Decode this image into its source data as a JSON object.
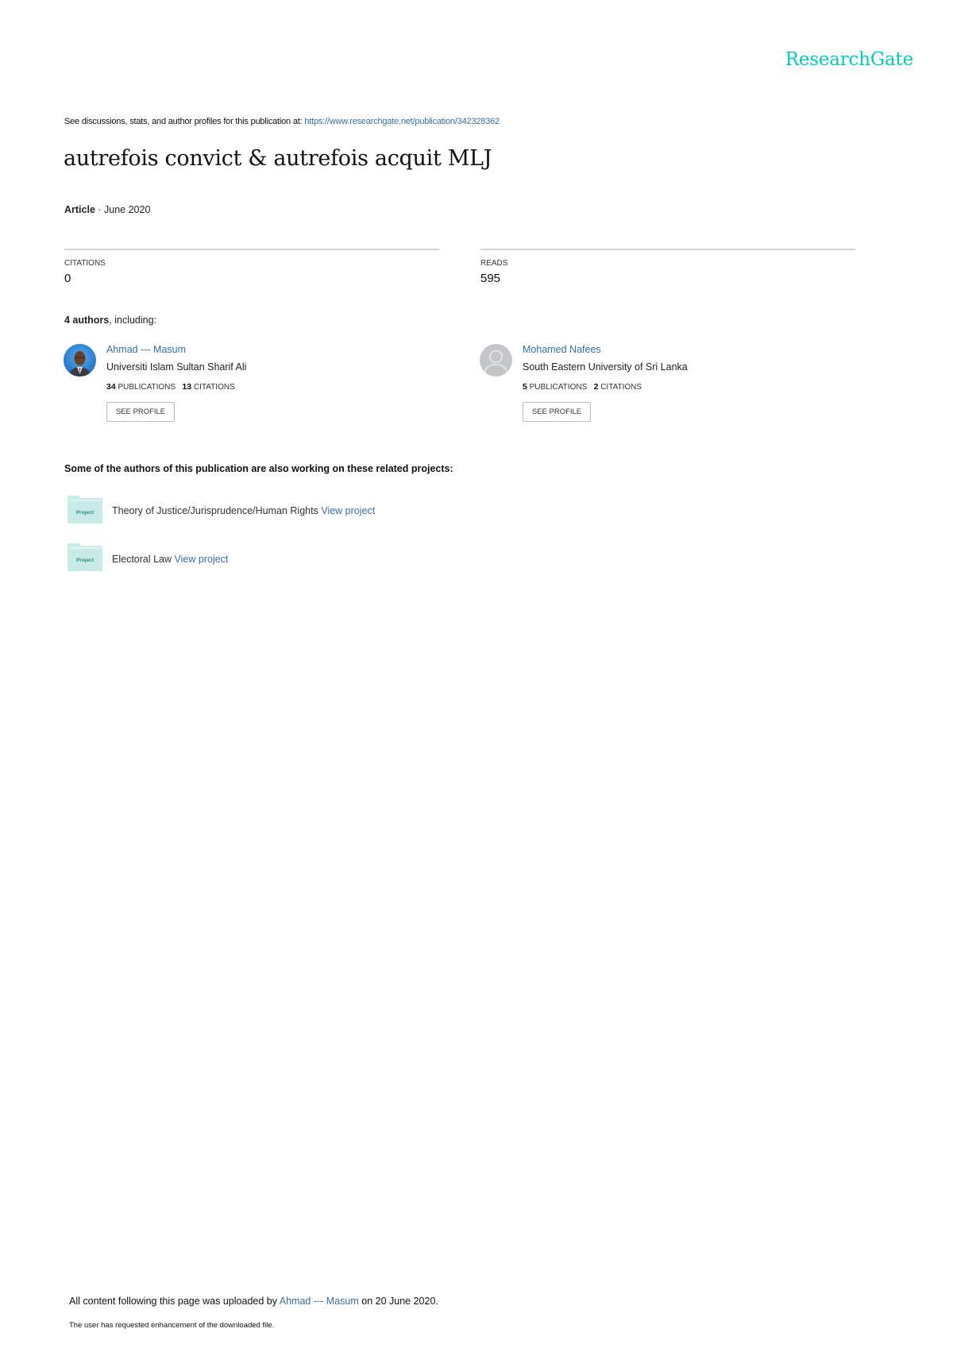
{
  "brand": {
    "logo_text": "ResearchGate",
    "accent_color": "#00ccbb",
    "link_color": "#3a6f9a"
  },
  "header": {
    "discussion_prefix": "See discussions, stats, and author profiles for this publication at: ",
    "publication_url": "https://www.researchgate.net/publication/342328362"
  },
  "publication": {
    "title": "autrefois convict & autrefois acquit MLJ",
    "type": "Article",
    "separator": " · ",
    "date": "June 2020"
  },
  "stats": {
    "citations_label": "CITATIONS",
    "citations_value": "0",
    "reads_label": "READS",
    "reads_value": "595"
  },
  "authors_summary": {
    "count": "4 authors",
    "suffix": ", including:"
  },
  "authors": [
    {
      "name": "Ahmad --- Masum",
      "institution": "Universiti Islam Sultan Sharif Ali",
      "publications_count": "34",
      "publications_label": "PUBLICATIONS",
      "citations_count": "13",
      "citations_label": "CITATIONS",
      "button_label": "SEE PROFILE",
      "avatar": "photo"
    },
    {
      "name": "Mohamed Nafees",
      "institution": "South Eastern University of Sri Lanka",
      "publications_count": "5",
      "publications_label": "PUBLICATIONS",
      "citations_count": "2",
      "citations_label": "CITATIONS",
      "button_label": "SEE PROFILE",
      "avatar": "default-user"
    }
  ],
  "projects": {
    "heading": "Some of the authors of this publication are also working on these related projects:",
    "folder_label": "Project",
    "items": [
      {
        "title": "Theory of Justice/Jurisprudence/Human Rights",
        "link": "View project"
      },
      {
        "title": "Electoral Law",
        "link": "View project"
      }
    ]
  },
  "footer": {
    "uploaded_prefix": "All content following this page was uploaded by ",
    "uploader": "Ahmad --- Masum",
    "uploaded_suffix": " on 20 June 2020.",
    "note": "The user has requested enhancement of the downloaded file."
  }
}
